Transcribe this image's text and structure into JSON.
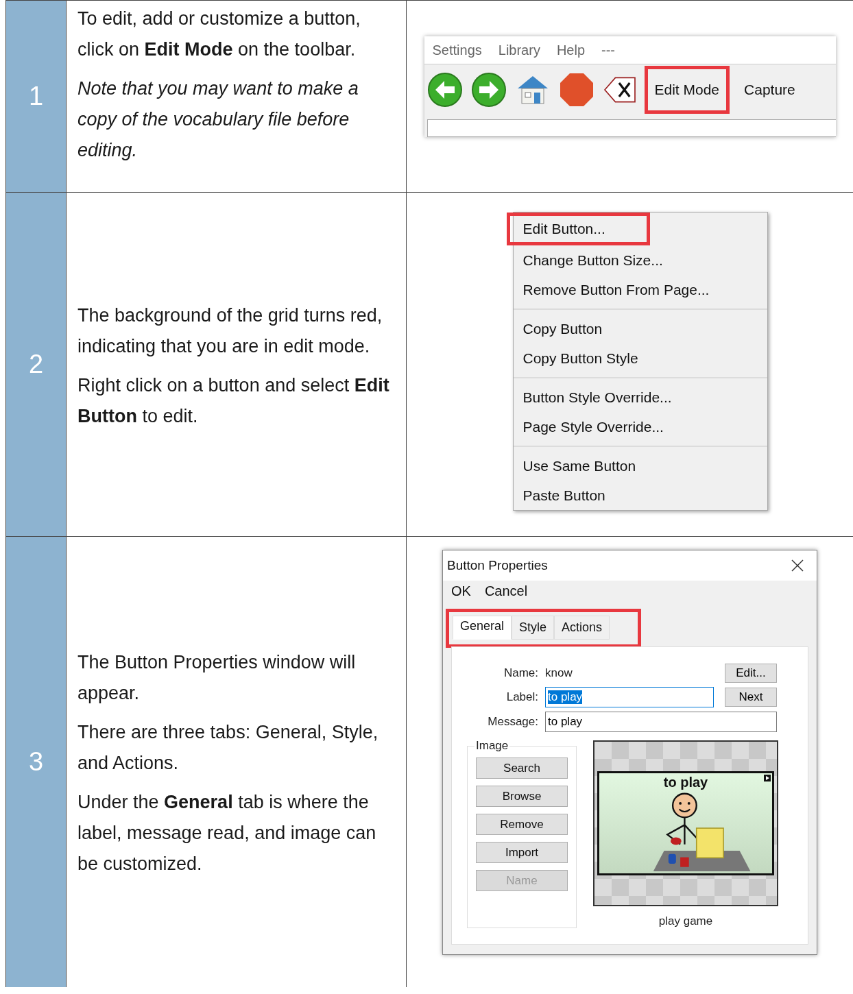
{
  "steps": [
    {
      "number": "1",
      "paragraphs": [
        {
          "text": "To edit, add or customize a button, click on **Edit Mode** on the toolbar.",
          "italic": false
        },
        {
          "text": "Note that you may want to make a copy of the vocabulary file before editing.",
          "italic": true
        }
      ],
      "screenshot": {
        "kind": "toolbar",
        "menu": [
          "Settings",
          "Library",
          "Help",
          "---"
        ],
        "buttons": [
          {
            "label": "Edit Mode",
            "highlighted": true
          },
          {
            "label": "Capture",
            "highlighted": false
          }
        ]
      }
    },
    {
      "number": "2",
      "paragraphs": [
        {
          "text": "The background of the grid turns red, indicating that you are in edit mode.",
          "italic": false
        },
        {
          "text": "Right click on a button and select **Edit Button** to edit.",
          "italic": false
        }
      ],
      "screenshot": {
        "kind": "context_menu",
        "groups": [
          [
            {
              "label": "Edit Button...",
              "highlighted": true
            },
            {
              "label": "Change Button Size...",
              "highlighted": false
            },
            {
              "label": "Remove Button From Page...",
              "highlighted": false
            }
          ],
          [
            {
              "label": "Copy Button",
              "highlighted": false
            },
            {
              "label": "Copy Button Style",
              "highlighted": false
            }
          ],
          [
            {
              "label": "Button Style Override...",
              "highlighted": false
            },
            {
              "label": "Page Style Override...",
              "highlighted": false
            }
          ],
          [
            {
              "label": "Use Same Button",
              "highlighted": false
            },
            {
              "label": "Paste Button",
              "highlighted": false
            }
          ]
        ]
      }
    },
    {
      "number": "3",
      "paragraphs": [
        {
          "text": "The Button Properties window will appear.",
          "italic": false
        },
        {
          "text": "There are three tabs: General, Style, and Actions.",
          "italic": false
        },
        {
          "text": "Under the **General** tab is where the label, message read, and image can be customized.",
          "italic": false
        }
      ],
      "screenshot": {
        "kind": "dialog",
        "title": "Button Properties",
        "menu": [
          "OK",
          "Cancel"
        ],
        "tabs_highlighted": true,
        "tabs": [
          {
            "label": "General",
            "selected": true
          },
          {
            "label": "Style",
            "selected": false
          },
          {
            "label": "Actions",
            "selected": false
          }
        ],
        "name_label": "Name:",
        "name_value": "know",
        "edit_button": "Edit...",
        "label_label": "Label:",
        "label_value": "to play",
        "next_button": "Next",
        "message_label": "Message:",
        "message_value": "to play",
        "image_group": "Image",
        "image_buttons": [
          {
            "label": "Search",
            "disabled": false
          },
          {
            "label": "Browse",
            "disabled": false
          },
          {
            "label": "Remove",
            "disabled": false
          },
          {
            "label": "Import",
            "disabled": false
          },
          {
            "label": "Name",
            "disabled": true
          }
        ],
        "preview_label": "to play",
        "preview_caption": "play game"
      }
    }
  ]
}
